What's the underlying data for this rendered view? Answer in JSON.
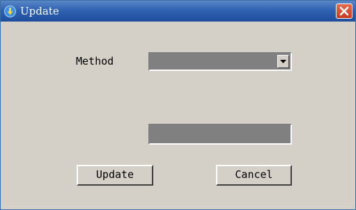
{
  "window": {
    "title": "Update",
    "title_icon": "update-arrow-icon",
    "close_icon": "close-icon",
    "titlebar_color": "#2f62b3",
    "close_color": "#c83a1e",
    "face_color": "#d4d0c8"
  },
  "form": {
    "method_label": "Method",
    "method_selected": "",
    "dropdown_icon": "chevron-down-icon",
    "text_value": ""
  },
  "buttons": {
    "update_label": "Update",
    "cancel_label": "Cancel"
  }
}
